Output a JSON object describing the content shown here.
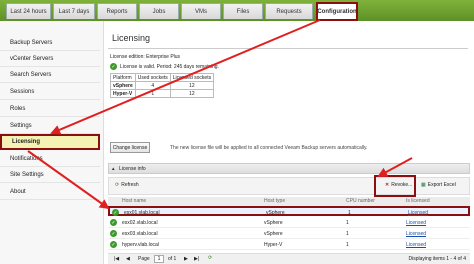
{
  "tabs": [
    "Last 24 hours",
    "Last 7 days",
    "Reports",
    "Jobs",
    "VMs",
    "Files",
    "Requests",
    "Configuration"
  ],
  "sidebar": {
    "items": [
      "Backup Servers",
      "vCenter Servers",
      "Search Servers",
      "Sessions",
      "Roles",
      "Settings",
      "Licensing",
      "Notifications",
      "Site Settings",
      "About"
    ]
  },
  "main": {
    "title": "Licensing",
    "edition": "License edition: Enterprise Plus",
    "validity": "License is valid. Period: 245 days remaining.",
    "license_table": {
      "headers": [
        "Platform",
        "Used sockets",
        "Licensed sockets"
      ],
      "rows": [
        [
          "vSphere",
          "4",
          "12"
        ],
        [
          "Hyper-V",
          "1",
          "12"
        ]
      ]
    },
    "change_license": "Change license",
    "note": "The new license file will be applied to all connected Veeam Backup servers automatically.",
    "section": "License info",
    "toolbar": {
      "refresh": "Refresh",
      "revoke": "Revoke...",
      "export": "Export Excel"
    },
    "grid": {
      "headers": [
        "Host name",
        "Host type",
        "CPU number",
        "Is licensed"
      ],
      "rows": [
        [
          "esx01.vlab.local",
          "vSphere",
          "1",
          "Licensed"
        ],
        [
          "esx02.vlab.local",
          "vSphere",
          "1",
          "Licensed"
        ],
        [
          "esx03.vlab.local",
          "vSphere",
          "1",
          "Licensed"
        ],
        [
          "hyperv.vlab.local",
          "Hyper-V",
          "1",
          "Licensed"
        ]
      ]
    },
    "pager": {
      "page": "1",
      "of": "of 1",
      "status": "Displaying items 1 - 4 of 4"
    }
  },
  "colors": {
    "topbar": "#6ea032",
    "highlight": "#8b0f0f",
    "link": "#1a4fa8"
  }
}
